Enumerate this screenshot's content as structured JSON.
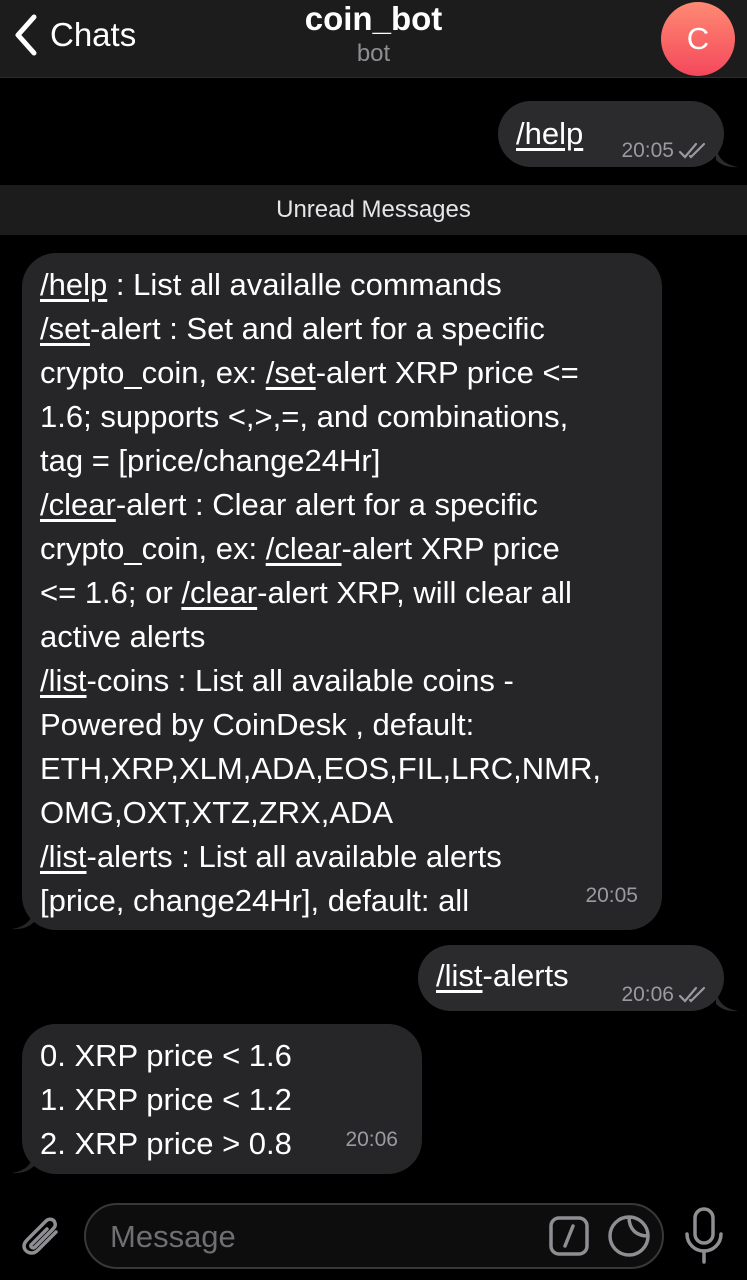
{
  "header": {
    "back_label": "Chats",
    "title": "coin_bot",
    "subtitle": "bot",
    "avatar_letter": "C"
  },
  "messages": [
    {
      "direction": "outgoing",
      "command": "/help",
      "text": "",
      "time": "20:05",
      "status": "read-double-check"
    },
    {
      "direction": "incoming",
      "lines": [
        [
          "/help",
          " : List all availalle commands"
        ],
        [
          "/set",
          "-alert : Set and alert for a specific"
        ],
        [
          "crypto_coin, ex: ",
          "/set",
          "-alert XRP price <="
        ],
        [
          "1.6; supports <,>,=, and combinations,"
        ],
        [
          "tag = [price/change24Hr]"
        ],
        [
          "/clear",
          "-alert : Clear alert for a specific"
        ],
        [
          "crypto_coin, ex: ",
          "/clear",
          "-alert XRP price"
        ],
        [
          "<= 1.6; or ",
          "/clear",
          "-alert XRP, will clear all"
        ],
        [
          "active alerts"
        ],
        [
          "/list",
          "-coins : List all available coins -"
        ],
        [
          "Powered by CoinDesk , default:"
        ],
        [
          "ETH,XRP,XLM,ADA,EOS,FIL,LRC,NMR,"
        ],
        [
          "OMG,OXT,XTZ,ZRX,ADA"
        ],
        [
          "/list",
          "-alerts : List all available alerts"
        ],
        [
          "[price, change24Hr], default: all"
        ]
      ],
      "time": "20:05"
    },
    {
      "direction": "outgoing",
      "command": "/list",
      "text": "-alerts",
      "time": "20:06",
      "status": "read-double-check"
    },
    {
      "direction": "incoming",
      "lines": [
        [
          "0. XRP price < 1.6"
        ],
        [
          "1. XRP price < 1.2"
        ],
        [
          "2. XRP price > 0.8"
        ]
      ],
      "time": "20:06"
    }
  ],
  "unread_divider": "Unread Messages",
  "composer": {
    "placeholder": "Message",
    "value": ""
  },
  "icons": {
    "back": "chevron-left-icon",
    "attach": "paperclip-icon",
    "commands": "slash-command-icon",
    "sticker": "sticker-icon",
    "mic": "microphone-icon",
    "read": "double-check-icon"
  },
  "colors": {
    "background": "#000000",
    "header": "#1c1c1d",
    "bubble_outgoing": "#2b2b2d",
    "bubble_incoming": "#262628",
    "avatar_gradient_top": "#ff8a73",
    "avatar_gradient_bottom": "#f4485b",
    "time_text": "#9a9aa0"
  }
}
